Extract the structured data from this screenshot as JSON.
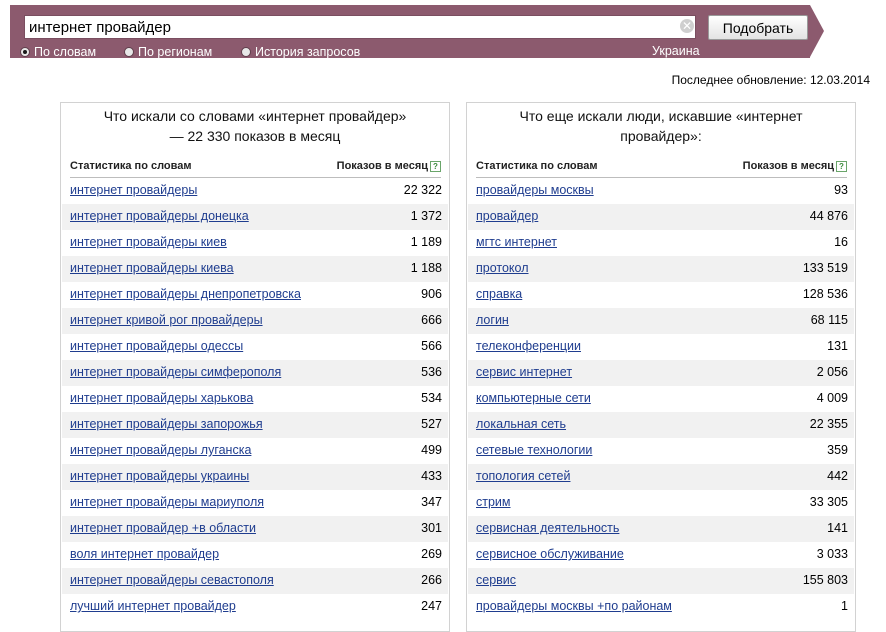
{
  "search": {
    "query": "интернет провайдер",
    "clear_icon": "clear-icon",
    "submit_label": "Подобрать",
    "modes": [
      {
        "label": "По словам",
        "checked": true
      },
      {
        "label": "По регионам",
        "checked": false
      },
      {
        "label": "История запросов",
        "checked": false
      }
    ],
    "region": "Украина",
    "bar_color": "#8c5a6e"
  },
  "last_update": "Последнее обновление: 12.03.2014",
  "left_panel": {
    "title": "Что искали со словами «интернет провайдер» — 22 330 показов в месяц",
    "col_phrase": "Статистика по словам",
    "col_count": "Показов в месяц",
    "help": "?",
    "rows": [
      {
        "phrase": "интернет провайдеры",
        "count": "22 322"
      },
      {
        "phrase": "интернет провайдеры донецка",
        "count": "1 372"
      },
      {
        "phrase": "интернет провайдеры киев",
        "count": "1 189"
      },
      {
        "phrase": "интернет провайдеры киева",
        "count": "1 188"
      },
      {
        "phrase": "интернет провайдеры днепропетровска",
        "count": "906"
      },
      {
        "phrase": "интернет кривой рог провайдеры",
        "count": "666"
      },
      {
        "phrase": "интернет провайдеры одессы",
        "count": "566"
      },
      {
        "phrase": "интернет провайдеры симферополя",
        "count": "536"
      },
      {
        "phrase": "интернет провайдеры харькова",
        "count": "534"
      },
      {
        "phrase": "интернет провайдеры запорожья",
        "count": "527"
      },
      {
        "phrase": "интернет провайдеры луганска",
        "count": "499"
      },
      {
        "phrase": "интернет провайдеры украины",
        "count": "433"
      },
      {
        "phrase": "интернет провайдеры мариуполя",
        "count": "347"
      },
      {
        "phrase": "интернет провайдер +в области",
        "count": "301"
      },
      {
        "phrase": "воля интернет провайдер",
        "count": "269"
      },
      {
        "phrase": "интернет провайдеры севастополя",
        "count": "266"
      },
      {
        "phrase": "лучший интернет провайдер",
        "count": "247"
      }
    ]
  },
  "right_panel": {
    "title": "Что еще искали люди, искавшие «интернет провайдер»:",
    "col_phrase": "Статистика по словам",
    "col_count": "Показов в месяц",
    "help": "?",
    "rows": [
      {
        "phrase": "провайдеры москвы",
        "count": "93"
      },
      {
        "phrase": "провайдер",
        "count": "44 876"
      },
      {
        "phrase": "мгтс интернет",
        "count": "16"
      },
      {
        "phrase": "протокол",
        "count": "133 519"
      },
      {
        "phrase": "справка",
        "count": "128 536"
      },
      {
        "phrase": "логин",
        "count": "68 115"
      },
      {
        "phrase": "телеконференции",
        "count": "131"
      },
      {
        "phrase": "сервис интернет",
        "count": "2 056"
      },
      {
        "phrase": "компьютерные сети",
        "count": "4 009"
      },
      {
        "phrase": "локальная сеть",
        "count": "22 355"
      },
      {
        "phrase": "сетевые технологии",
        "count": "359"
      },
      {
        "phrase": "топология сетей",
        "count": "442"
      },
      {
        "phrase": "стрим",
        "count": "33 305"
      },
      {
        "phrase": "сервисная деятельность",
        "count": "141"
      },
      {
        "phrase": "сервисное обслуживание",
        "count": "3 033"
      },
      {
        "phrase": "сервис",
        "count": "155 803"
      },
      {
        "phrase": "провайдеры москвы +по районам",
        "count": "1"
      }
    ]
  }
}
